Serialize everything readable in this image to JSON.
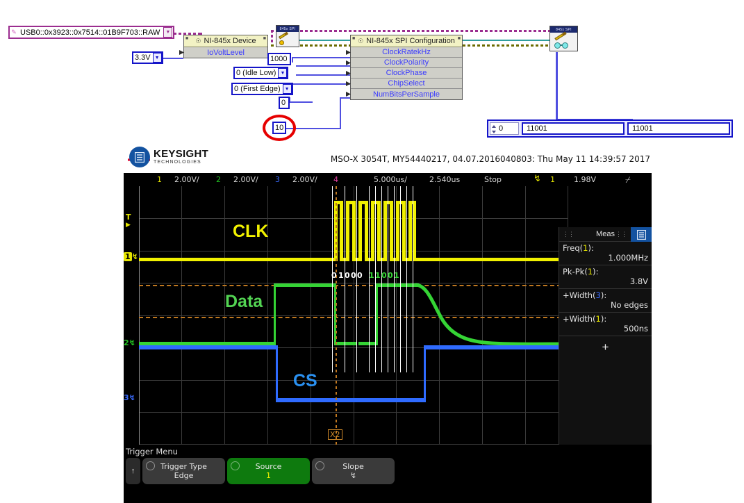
{
  "labview": {
    "resource_string": "USB0::0x3923::0x7514::01B9F703::RAW",
    "io_volt_level": "3.3V",
    "device_vi": {
      "title": "NI-845x Device",
      "inputs": [
        "IoVoltLevel"
      ]
    },
    "spi_config_vi": {
      "title": "NI-845x SPI Configuration",
      "inputs": [
        "ClockRatekHz",
        "ClockPolarity",
        "ClockPhase",
        "ChipSelect",
        "NumBitsPerSample"
      ]
    },
    "constants": {
      "clock_rate_khz": "1000",
      "clock_polarity": "0 (Idle Low)",
      "clock_phase": "0 (First Edge)",
      "chip_select": "0",
      "num_bits_per_sample": "10"
    },
    "spi_write_icon_caption": "845x SPI",
    "array_indicator": {
      "index": "0",
      "cells": [
        "11001",
        "11001"
      ]
    }
  },
  "scope": {
    "brand": {
      "name": "KEYSIGHT",
      "sub": "TECHNOLOGIES"
    },
    "identity": "MSO-X 3054T, MY54440217, 04.07.2016040803: Thu May 11 14:39:57 2017",
    "status": {
      "ch1_num": "1",
      "ch1_scale": "2.00V/",
      "ch2_num": "2",
      "ch2_scale": "2.00V/",
      "ch3_num": "3",
      "ch3_scale": "2.00V/",
      "ch4_num": "4",
      "ch4_scale": "",
      "timebase": "5.000us/",
      "delay": "2.540us",
      "run_state": "Stop",
      "trig_slope_glyph": "↯",
      "trig_source": "1",
      "trig_level": "1.98V"
    },
    "channel_markers": [
      {
        "label": "T",
        "color": "#e5e500"
      },
      {
        "label": "1",
        "color": "#e5e500"
      },
      {
        "label": "2",
        "color": "#22c322"
      },
      {
        "label": "3",
        "color": "#3a6bff"
      }
    ],
    "waveform_labels": [
      {
        "text": "CLK",
        "color": "#f2f200"
      },
      {
        "text": "Data",
        "color": "#53d453"
      },
      {
        "text": "CS",
        "color": "#2a90f0"
      }
    ],
    "decoded_bits": [
      {
        "v": "0",
        "c": "w"
      },
      {
        "v": "1",
        "c": "w"
      },
      {
        "v": "0",
        "c": "w"
      },
      {
        "v": "0",
        "c": "w"
      },
      {
        "v": "0",
        "c": "w"
      },
      {
        "v": "1",
        "c": "g"
      },
      {
        "v": "1",
        "c": "g"
      },
      {
        "v": "0",
        "c": "g"
      },
      {
        "v": "0",
        "c": "g"
      },
      {
        "v": "1",
        "c": "g"
      }
    ],
    "zoom_marker": "X2",
    "measurements": {
      "title": "Meas",
      "items": [
        {
          "name": "Freq(",
          "ch": "1",
          "ch_color": "#e5e500",
          "tail": "):",
          "value": "1.000MHz"
        },
        {
          "name": "Pk-Pk(",
          "ch": "1",
          "ch_color": "#e5e500",
          "tail": "):",
          "value": "3.8V"
        },
        {
          "name": "+Width(",
          "ch": "3",
          "ch_color": "#3a6bff",
          "tail": "):",
          "value": "No edges"
        },
        {
          "name": "+Width(",
          "ch": "1",
          "ch_color": "#e5e500",
          "tail": "):",
          "value": "500ns"
        }
      ],
      "add_glyph": "+"
    },
    "trigger_menu": {
      "title": "Trigger Menu",
      "up_glyph": "↑",
      "keys": [
        {
          "label": "Trigger Type",
          "value": "Edge",
          "active": false
        },
        {
          "label": "Source",
          "value": "1",
          "active": true
        },
        {
          "label": "Slope",
          "value": "↯",
          "active": false
        }
      ]
    }
  }
}
